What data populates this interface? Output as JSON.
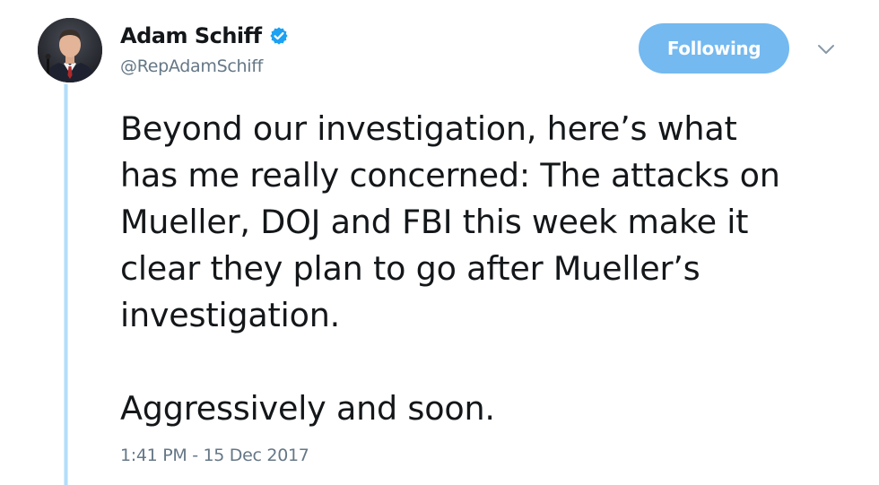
{
  "author": {
    "display_name": "Adam Schiff",
    "handle": "@RepAdamSchiff",
    "verified": true,
    "avatar_icon": "profile-photo"
  },
  "follow_button": {
    "label": "Following"
  },
  "menu": {
    "icon": "chevron-down-icon"
  },
  "tweet": {
    "lines": [
      "Beyond our investigation, here’s what",
      "has me really concerned: The attacks on",
      "Mueller, DOJ and FBI this week make it",
      "clear they plan to go after Mueller’s",
      "investigation."
    ],
    "second_paragraph": "Aggressively and soon.",
    "timestamp": "1:41 PM - 15 Dec 2017"
  },
  "colors": {
    "verified": "#1da1f2",
    "follow_button_bg": "#74b9f0",
    "thread_line": "#b3defb",
    "secondary_text": "#657786"
  }
}
